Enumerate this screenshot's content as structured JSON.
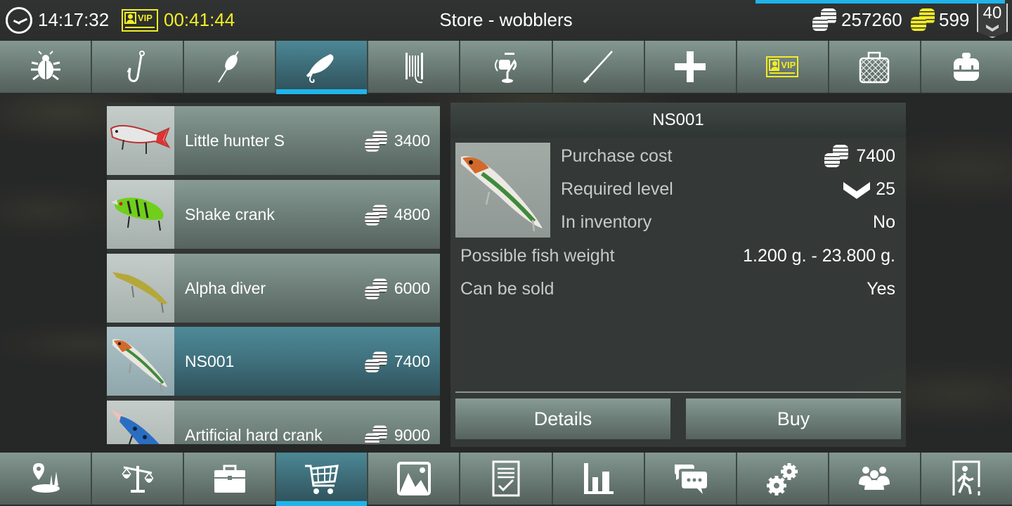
{
  "status_bar": {
    "clock_time": "14:17:32",
    "vip_label": "VIP",
    "vip_timer": "00:41:44",
    "title": "Store - wobblers",
    "silver_coins": "257260",
    "gold_coins": "599",
    "player_level": "40",
    "xp_progress_percent": 100
  },
  "top_tabs": [
    {
      "name": "baits",
      "icon": "bug-icon",
      "active": false
    },
    {
      "name": "hooks",
      "icon": "hook-icon",
      "active": false
    },
    {
      "name": "floats",
      "icon": "float-icon",
      "active": false
    },
    {
      "name": "wobblers",
      "icon": "wobbler-icon",
      "active": true
    },
    {
      "name": "lines",
      "icon": "line-spool-icon",
      "active": false
    },
    {
      "name": "reels",
      "icon": "reel-icon",
      "active": false
    },
    {
      "name": "rods",
      "icon": "rod-icon",
      "active": false
    },
    {
      "name": "extras",
      "icon": "plus-icon",
      "active": false
    },
    {
      "name": "vip",
      "icon": "vip-card-icon",
      "active": false,
      "label": "VIP"
    },
    {
      "name": "keepnets",
      "icon": "keepnet-icon",
      "active": false
    },
    {
      "name": "backpacks",
      "icon": "backpack-icon",
      "active": false
    }
  ],
  "items": [
    {
      "name": "Little hunter S",
      "price": "3400",
      "selected": false
    },
    {
      "name": "Shake crank",
      "price": "4800",
      "selected": false
    },
    {
      "name": "Alpha diver",
      "price": "6000",
      "selected": false
    },
    {
      "name": "NS001",
      "price": "7400",
      "selected": true
    },
    {
      "name": "Artificial hard crank",
      "price": "9000",
      "selected": false
    }
  ],
  "detail": {
    "title": "NS001",
    "purchase_cost_label": "Purchase cost",
    "purchase_cost": "7400",
    "required_level_label": "Required level",
    "required_level": "25",
    "in_inventory_label": "In inventory",
    "in_inventory": "No",
    "fish_weight_label": "Possible fish weight",
    "fish_weight": "1.200 g. - 23.800 g.",
    "can_be_sold_label": "Can be sold",
    "can_be_sold": "Yes",
    "details_button": "Details",
    "buy_button": "Buy"
  },
  "bottom_tabs": [
    {
      "name": "map",
      "icon": "map-location-icon",
      "active": false
    },
    {
      "name": "scales",
      "icon": "scales-icon",
      "active": false
    },
    {
      "name": "tackle-box",
      "icon": "toolbox-icon",
      "active": false
    },
    {
      "name": "store",
      "icon": "cart-icon",
      "active": true
    },
    {
      "name": "gallery",
      "icon": "picture-icon",
      "active": false
    },
    {
      "name": "quests",
      "icon": "checklist-icon",
      "active": false
    },
    {
      "name": "statistics",
      "icon": "bar-chart-icon",
      "active": false
    },
    {
      "name": "chat",
      "icon": "chat-icon",
      "active": false
    },
    {
      "name": "settings",
      "icon": "gears-icon",
      "active": false
    },
    {
      "name": "friends",
      "icon": "users-icon",
      "active": false
    },
    {
      "name": "exit",
      "icon": "exit-door-icon",
      "active": false
    }
  ],
  "colors": {
    "accent": "#1fb4ea",
    "vip_yellow": "#f2ec25",
    "tab_active": "#3e6e7a",
    "tab_inactive": "#6d7e78"
  }
}
